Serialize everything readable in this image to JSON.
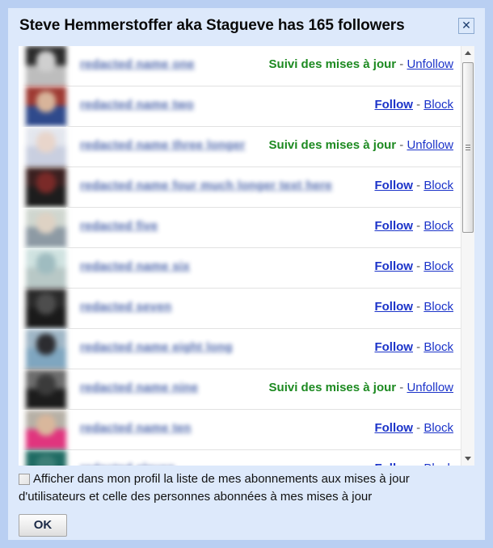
{
  "dialog": {
    "title": "Steve Hemmerstoffer aka Stagueve has 165 followers",
    "close_label": "✕"
  },
  "labels": {
    "following_status": "Suivi des mises à jour",
    "unfollow": "Unfollow",
    "follow": "Follow",
    "block": "Block",
    "separator": "-"
  },
  "colors": {
    "dialog_background": "#dde9fb",
    "window_border": "#b9cff2",
    "list_background": "#ffffff",
    "following_green": "#1d8a21",
    "link_blue": "#1b33c9",
    "username_blue": "#2c4a9c"
  },
  "followers": [
    {
      "name": "redacted name one",
      "state": "following",
      "avatar_top": "#2b2b2b",
      "avatar_bottom": "#bdbdbd",
      "avatar_face": "#cfcfcf"
    },
    {
      "name": "redacted name two",
      "state": "not_following",
      "avatar_top": "#9e3a33",
      "avatar_bottom": "#2f4a8c",
      "avatar_face": "#d8b49a"
    },
    {
      "name": "redacted name three longer",
      "state": "following",
      "avatar_top": "#e3e6ee",
      "avatar_bottom": "#c9cfe0",
      "avatar_face": "#e8d5cb"
    },
    {
      "name": "redacted name four much longer text here",
      "state": "not_following",
      "avatar_top": "#3a2020",
      "avatar_bottom": "#1d1d1d",
      "avatar_face": "#7a2a28"
    },
    {
      "name": "redacted five",
      "state": "not_following",
      "avatar_top": "#cfd6cf",
      "avatar_bottom": "#8d9aa4",
      "avatar_face": "#ded2c4"
    },
    {
      "name": "redacted name six",
      "state": "not_following",
      "avatar_top": "#cfe2e0",
      "avatar_bottom": "#b8c8c6",
      "avatar_face": "#9fbcc0"
    },
    {
      "name": "redacted seven",
      "state": "not_following",
      "avatar_top": "#2a2a2a",
      "avatar_bottom": "#1a1a1a",
      "avatar_face": "#4d4d4d"
    },
    {
      "name": "redacted name eight long",
      "state": "not_following",
      "avatar_top": "#9fb6c6",
      "avatar_bottom": "#7fa6c0",
      "avatar_face": "#2c2c30"
    },
    {
      "name": "redacted name nine",
      "state": "following",
      "avatar_top": "#6d6d6d",
      "avatar_bottom": "#1c1c1c",
      "avatar_face": "#3b3b3b"
    },
    {
      "name": "redacted name ten",
      "state": "not_following",
      "avatar_top": "#b6b0a6",
      "avatar_bottom": "#e0357e",
      "avatar_face": "#d9b79c"
    },
    {
      "name": "redacted eleven",
      "state": "not_following",
      "avatar_top": "#1f6b63",
      "avatar_bottom": "#2a2a2a",
      "avatar_face": "#3d7f77"
    }
  ],
  "footer": {
    "checkbox_label": "Afficher dans mon profil la liste de mes abonnements aux mises à jour d'utilisateurs et celle des personnes abonnées à mes mises à jour",
    "checkbox_checked": false,
    "ok_label": "OK"
  },
  "scrollbar": {
    "up_arrow": "▲",
    "down_arrow": "▼",
    "thumb_position_percent": 4
  }
}
